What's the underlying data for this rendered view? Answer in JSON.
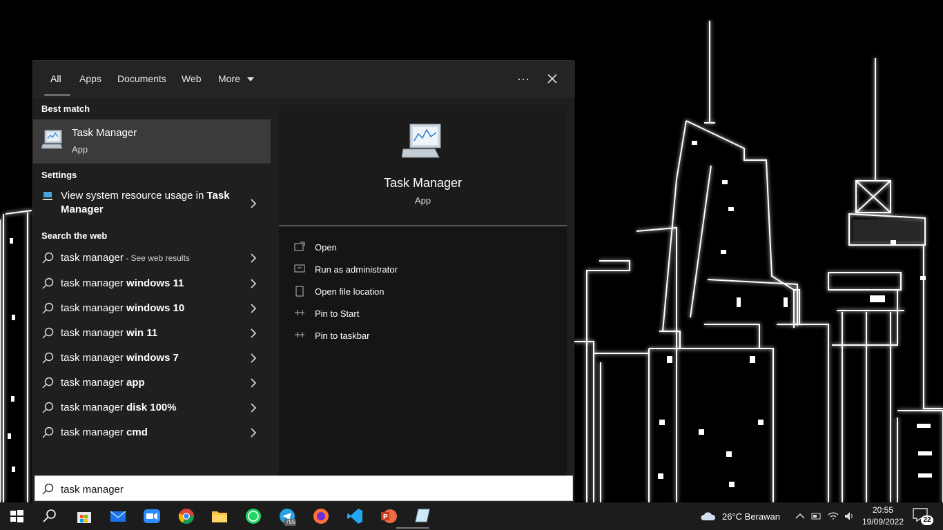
{
  "tabs": [
    {
      "label": "All",
      "active": true
    },
    {
      "label": "Apps"
    },
    {
      "label": "Documents"
    },
    {
      "label": "Web"
    },
    {
      "label": "More"
    }
  ],
  "sections": {
    "best_match": "Best match",
    "settings": "Settings",
    "search_web": "Search the web"
  },
  "best_match": {
    "title": "Task Manager",
    "subtitle": "App"
  },
  "settings_item": {
    "text": "View system resource usage in ",
    "bold": "Task Manager"
  },
  "web_results": [
    {
      "plain": "task manager",
      "bold": "",
      "hint": " - See web results"
    },
    {
      "plain": "task manager ",
      "bold": "windows 11",
      "hint": ""
    },
    {
      "plain": "task manager ",
      "bold": "windows 10",
      "hint": ""
    },
    {
      "plain": "task manager ",
      "bold": "win 11",
      "hint": ""
    },
    {
      "plain": "task manager ",
      "bold": "windows 7",
      "hint": ""
    },
    {
      "plain": "task manager ",
      "bold": "app",
      "hint": ""
    },
    {
      "plain": "task manager ",
      "bold": "disk 100%",
      "hint": ""
    },
    {
      "plain": "task manager ",
      "bold": "cmd",
      "hint": ""
    }
  ],
  "detail": {
    "title": "Task Manager",
    "subtitle": "App",
    "actions": [
      "Open",
      "Run as administrator",
      "Open file location",
      "Pin to Start",
      "Pin to taskbar"
    ]
  },
  "search": {
    "value": "task manager"
  },
  "taskbar": {
    "apps": [
      "start-icon",
      "search-icon",
      "microsoft-store-icon",
      "mail-icon",
      "zoom-icon",
      "chrome-icon",
      "file-explorer-icon",
      "whatsapp-icon",
      "telegram-icon",
      "firefox-icon",
      "vscode-icon",
      "powerpoint-icon",
      "task-manager-icon"
    ],
    "telegram_badge": "755",
    "weather": "26°C  Berawan",
    "time": "20:55",
    "date": "19/09/2022",
    "notifications": "22"
  },
  "colors": {
    "panel": "#1f1f1f",
    "selected": "#3b3b3b",
    "taskbar": "#1c1c1c"
  }
}
